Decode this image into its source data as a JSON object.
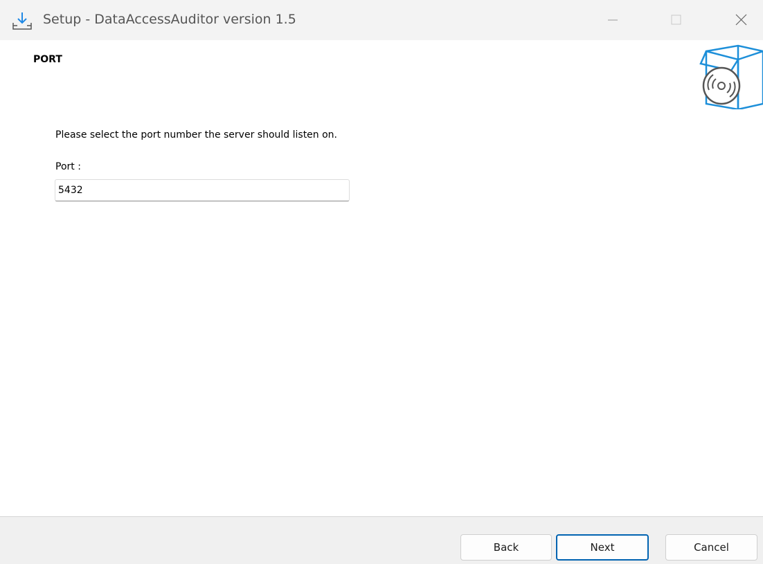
{
  "window": {
    "title": "Setup - DataAccessAuditor version 1.5",
    "controls": [
      "minimize",
      "maximize",
      "close"
    ]
  },
  "page": {
    "title": "PORT",
    "instruction": "Please select the port number the server should listen on."
  },
  "port": {
    "label": "Port :",
    "value": "5432"
  },
  "buttons": {
    "back": "Back",
    "next": "Next",
    "cancel": "Cancel"
  },
  "icons": {
    "app": "download-tray-icon",
    "header": "box-disc-icon"
  },
  "colors": {
    "accent": "#0063b1",
    "box_blue": "#1d8fd9"
  }
}
